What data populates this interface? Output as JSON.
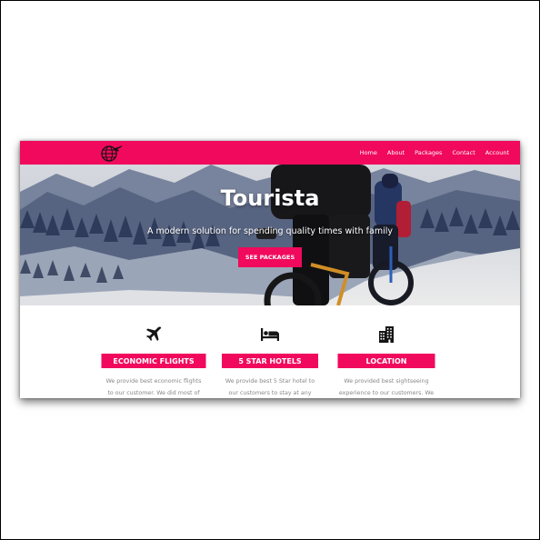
{
  "brand": {
    "primary_color": "#f0095c",
    "logo_icon": "globe-plane-icon"
  },
  "nav": {
    "items": [
      {
        "label": "Home"
      },
      {
        "label": "About"
      },
      {
        "label": "Packages"
      },
      {
        "label": "Contact"
      },
      {
        "label": "Account"
      }
    ]
  },
  "hero": {
    "title": "Tourista",
    "subtitle": "A modern solution for spending quality times with family",
    "button_label": "SEE PACKAGES"
  },
  "features": [
    {
      "icon": "plane-icon",
      "title": "ECONOMIC FLIGHTS",
      "desc_line1": "We provide best economic flights",
      "desc_line2": "to our customer. We did most of"
    },
    {
      "icon": "bed-icon",
      "title": "5 STAR HOTELS",
      "desc_line1": "We provide best 5 Star hotel to",
      "desc_line2": "our customers to stay at any"
    },
    {
      "icon": "building-icon",
      "title": "LOCATION",
      "desc_line1": "We provided best sightseeing",
      "desc_line2": "experience to our customers. We"
    }
  ]
}
